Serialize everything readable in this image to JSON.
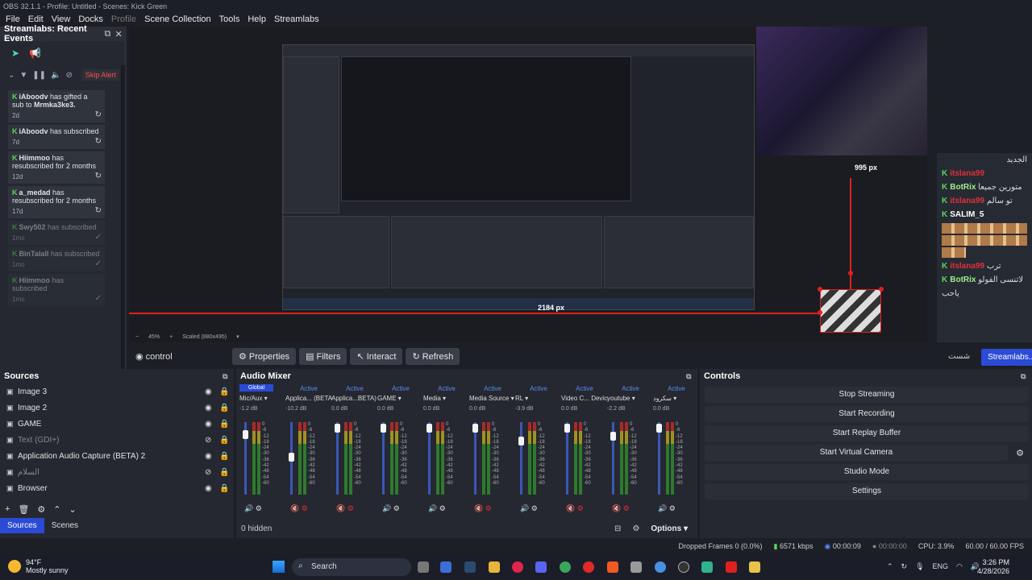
{
  "window_title": "OBS 32.1.1 - Profile: Untitled - Scenes: Kick Green",
  "menu": [
    "File",
    "Edit",
    "View",
    "Docks",
    "Profile",
    "Scene Collection",
    "Tools",
    "Help",
    "Streamlabs"
  ],
  "events_dock": {
    "title": "Streamlabs: Recent Events",
    "skip_label": "Skip Alert",
    "items": [
      {
        "user": "iAboodv",
        "text": "has gifted a sub to",
        "target": "Mrmka3ke3.",
        "time": "2d",
        "faded": false
      },
      {
        "user": "iAboodv",
        "text": "has subscribed",
        "target": "",
        "time": "7d",
        "faded": false
      },
      {
        "user": "Hiimmoo",
        "text": "has resubscribed for 2 months",
        "target": "",
        "time": "12d",
        "faded": false
      },
      {
        "user": "a_medad",
        "text": "has resubscribed for 2 months",
        "target": "",
        "time": "17d",
        "faded": false
      },
      {
        "user": "Swy502",
        "text": "has subscribed",
        "target": "",
        "time": "1mo",
        "faded": true
      },
      {
        "user": "BinTalall",
        "text": "has subscribed",
        "target": "",
        "time": "1mo",
        "faded": true
      },
      {
        "user": "Hiimmoo",
        "text": "has subscribed",
        "target": "",
        "time": "1mo",
        "faded": true
      }
    ]
  },
  "preview": {
    "height_label": "995 px",
    "width_label": "2184 px",
    "footer_zoom": "45%",
    "footer_scaled": "Scaled (880x495)"
  },
  "chat": {
    "header_text": "الجديد",
    "rows": [
      {
        "user": "itslana99",
        "style": "red",
        "msg": ""
      },
      {
        "user": "BotRix",
        "style": "grn",
        "msg": "متورين جميعا"
      },
      {
        "user": "itslana99",
        "style": "red",
        "msg": "تو سالم"
      },
      {
        "user": "SALIM_5",
        "style": "wh",
        "msg": ""
      }
    ],
    "rows2": [
      {
        "user": "itslana99",
        "style": "red",
        "msg": "ترب"
      },
      {
        "user": "BotRix",
        "style": "grn",
        "msg": "لاتنسى الفولو"
      }
    ],
    "footer_msg": "ياحب"
  },
  "control_bar": {
    "source_label": "control",
    "buttons": [
      "Properties",
      "Filters",
      "Interact",
      "Refresh"
    ],
    "right_left": "شست",
    "right_btn": "Streamlabs..."
  },
  "sources": {
    "title": "Sources",
    "items": [
      {
        "name": "Image 3",
        "dim": false
      },
      {
        "name": "Image 2",
        "dim": false
      },
      {
        "name": "GAME",
        "dim": false
      },
      {
        "name": "Text (GDI+)",
        "dim": true
      },
      {
        "name": "Application Audio Capture (BETA) 2",
        "dim": false
      },
      {
        "name": "السلام",
        "dim": true
      },
      {
        "name": "Browser",
        "dim": false
      }
    ],
    "tabs": [
      "Sources",
      "Scenes"
    ]
  },
  "mixer": {
    "title": "Audio Mixer",
    "global": "Global",
    "channels": [
      {
        "name": "Mic/Aux",
        "status": "",
        "db": "-1.2 dB",
        "muted": false,
        "knob": 10
      },
      {
        "name": "Applica... (BETA)",
        "status": "Active",
        "db": "-10.2 dB",
        "muted": true,
        "knob": 38
      },
      {
        "name": "Applica...BETA) 2",
        "status": "Active",
        "db": "0.0 dB",
        "muted": true,
        "knob": 2
      },
      {
        "name": "GAME",
        "status": "Active",
        "db": "0.0 dB",
        "muted": false,
        "knob": 2
      },
      {
        "name": "Media",
        "status": "Active",
        "db": "0.0 dB",
        "muted": false,
        "knob": 2
      },
      {
        "name": "Media Source",
        "status": "Active",
        "db": "0.0 dB",
        "muted": true,
        "knob": 2
      },
      {
        "name": "RL",
        "status": "Active",
        "db": "-3.9 dB",
        "muted": false,
        "knob": 18
      },
      {
        "name": "Video C... Device",
        "status": "Active",
        "db": "0.0 dB",
        "muted": true,
        "knob": 2
      },
      {
        "name": "youtube",
        "status": "Active",
        "db": "-2.2 dB",
        "muted": true,
        "knob": 12
      },
      {
        "name": "سكرود",
        "status": "Active",
        "db": "0.0 dB",
        "muted": false,
        "knob": 2
      }
    ],
    "scale": [
      "0",
      "-6",
      "-12",
      "-18",
      "-24",
      "-30",
      "-36",
      "-42",
      "-48",
      "-54",
      "-60"
    ],
    "hidden": "0 hidden",
    "options": "Options"
  },
  "controls": {
    "title": "Controls",
    "buttons": [
      "Stop Streaming",
      "Start Recording",
      "Start Replay Buffer",
      "Start Virtual Camera",
      "Studio Mode",
      "Settings"
    ]
  },
  "status": {
    "dropped": "Dropped Frames 0 (0.0%)",
    "kbps": "6571 kbps",
    "stream_time": "00:00:09",
    "rec_time": "00:00:00",
    "cpu": "CPU: 3.9%",
    "fps": "60.00 / 60.00 FPS"
  },
  "taskbar": {
    "temp": "94°F",
    "weather": "Mostly sunny",
    "search": "Search",
    "lang": "ENG",
    "time": "3:26 PM",
    "date": "4/28/2026"
  }
}
